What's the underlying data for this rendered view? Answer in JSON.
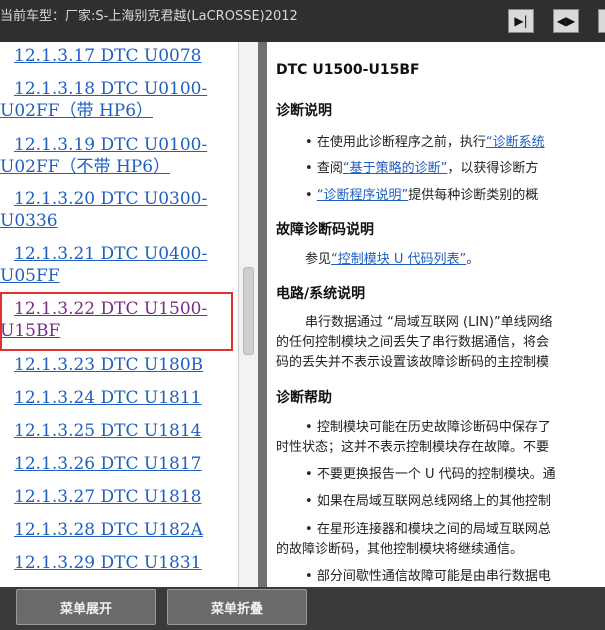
{
  "titlebar": {
    "title": "当前车型：厂家:S-上海别克君越(LaCROSSE)2012"
  },
  "toolbar": {
    "buttons": [
      "expand-right-icon",
      "split-view-icon",
      "collapse-left-icon"
    ]
  },
  "toc": {
    "items": [
      {
        "line1": "12.1.3.17 DTC U0078",
        "line2": ""
      },
      {
        "line1": "12.1.3.18 DTC U0100-",
        "line2": "U02FF（带 HP6）"
      },
      {
        "line1": "12.1.3.19 DTC U0100-",
        "line2": "U02FF（不带 HP6）"
      },
      {
        "line1": "12.1.3.20 DTC U0300-",
        "line2": "U0336"
      },
      {
        "line1": "12.1.3.21 DTC U0400-",
        "line2": "U05FF"
      },
      {
        "line1": "12.1.3.22 DTC U1500-",
        "line2": "U15BF"
      },
      {
        "line1": "12.1.3.23 DTC U180B",
        "line2": ""
      },
      {
        "line1": "12.1.3.24 DTC U1811",
        "line2": ""
      },
      {
        "line1": "12.1.3.25 DTC U1814",
        "line2": ""
      },
      {
        "line1": "12.1.3.26 DTC U1817",
        "line2": ""
      },
      {
        "line1": "12.1.3.27 DTC U1818",
        "line2": ""
      },
      {
        "line1": "12.1.3.28 DTC U182A",
        "line2": ""
      },
      {
        "line1": "12.1.3.29 DTC U1831",
        "line2": ""
      }
    ]
  },
  "content": {
    "title": "DTC U1500-U15BF",
    "sec1": "诊断说明",
    "sec1_b1_pre": "在使用此诊断程序之前，执行",
    "sec1_b1_link": "“诊断系统",
    "sec1_b2_pre": "查阅",
    "sec1_b2_link": "“基于策略的诊断”",
    "sec1_b2_post": "，以获得诊断方",
    "sec1_b3_link": "“诊断程序说明”",
    "sec1_b3_post": "提供每种诊断类别的概",
    "sec2": "故障诊断码说明",
    "sec2_pre": "参见",
    "sec2_link": "“控制模块 U 代码列表”",
    "sec2_post": "。",
    "sec3": "电路/系统说明",
    "sec3_l1": "串行数据通过 “局域互联网 (LIN)”单线网络",
    "sec3_l2": "的任何控制模块之间丢失了串行数据通信，将会",
    "sec3_l3": "码的丢失并不表示设置该故障诊断码的主控制模",
    "sec4": "诊断帮助",
    "sec4_b1_l1": "控制模块可能在历史故障诊断码中保存了",
    "sec4_b1_l2": "时性状态；这并不表示控制模块存在故障。不要",
    "sec4_b2": "不要更换报告一个 U 代码的控制模块。通",
    "sec4_b3": "如果在局域互联网总线网络上的其他控制",
    "sec4_b4_l1": "在星形连接器和模块之间的局域互联网总",
    "sec4_b4_l2": "的故障诊断码，其他控制模块将继续通信。",
    "sec4_b5": "部分间歇性通信故障可能是由串行数据电"
  },
  "footer": {
    "expand_label": "菜单展开",
    "collapse_label": "菜单折叠"
  }
}
